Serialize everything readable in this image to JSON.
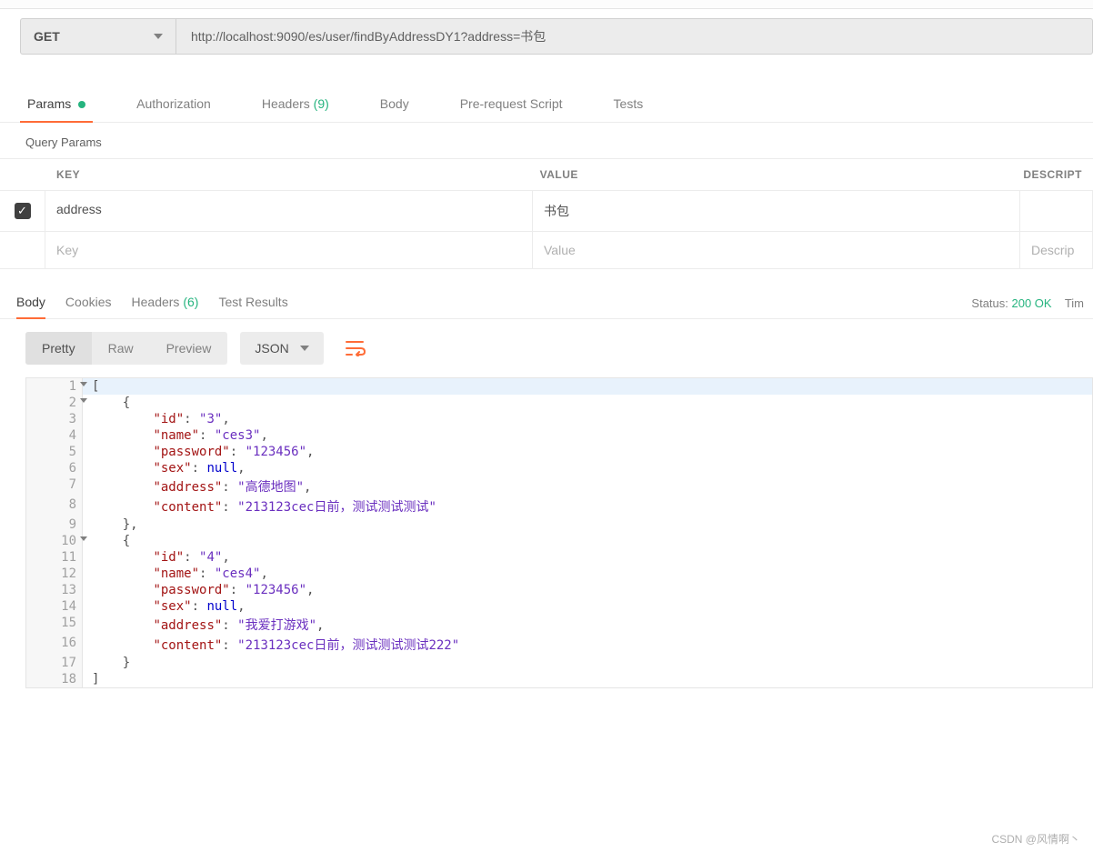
{
  "request": {
    "method": "GET",
    "url": "http://localhost:9090/es/user/findByAddressDY1?address=书包",
    "tabs": {
      "params": "Params",
      "authorization": "Authorization",
      "headers": "Headers",
      "headers_count": "(9)",
      "body": "Body",
      "prereq": "Pre-request Script",
      "tests": "Tests"
    },
    "section_label": "Query Params",
    "table": {
      "header_key": "KEY",
      "header_value": "VALUE",
      "header_desc": "DESCRIPT",
      "rows": [
        {
          "checked": true,
          "key": "address",
          "value": "书包"
        }
      ],
      "placeholder_key": "Key",
      "placeholder_value": "Value",
      "placeholder_desc": "Descrip"
    }
  },
  "response": {
    "tabs": {
      "body": "Body",
      "cookies": "Cookies",
      "headers": "Headers",
      "headers_count": "(6)",
      "tests": "Test Results"
    },
    "status_label": "Status:",
    "status_value": "200 OK",
    "time_label": "Tim",
    "format_tabs": {
      "pretty": "Pretty",
      "raw": "Raw",
      "preview": "Preview"
    },
    "type": "JSON",
    "body": [
      {
        "id": "3",
        "name": "ces3",
        "password": "123456",
        "sex": null,
        "address": "高德地图",
        "content": "213123cec日前，测试测试测试"
      },
      {
        "id": "4",
        "name": "ces4",
        "password": "123456",
        "sex": null,
        "address": "我爱打游戏",
        "content": "213123cec日前，测试测试测试222"
      }
    ],
    "lines": [
      "[",
      "    {",
      "        \"id\": \"3\",",
      "        \"name\": \"ces3\",",
      "        \"password\": \"123456\",",
      "        \"sex\": null,",
      "        \"address\": \"高德地图\",",
      "        \"content\": \"213123cec日前，测试测试测试\"",
      "    },",
      "    {",
      "        \"id\": \"4\",",
      "        \"name\": \"ces4\",",
      "        \"password\": \"123456\",",
      "        \"sex\": null,",
      "        \"address\": \"我爱打游戏\",",
      "        \"content\": \"213123cec日前，测试测试测试222\"",
      "    }",
      "]"
    ]
  },
  "watermark": "CSDN @风情啊丶"
}
